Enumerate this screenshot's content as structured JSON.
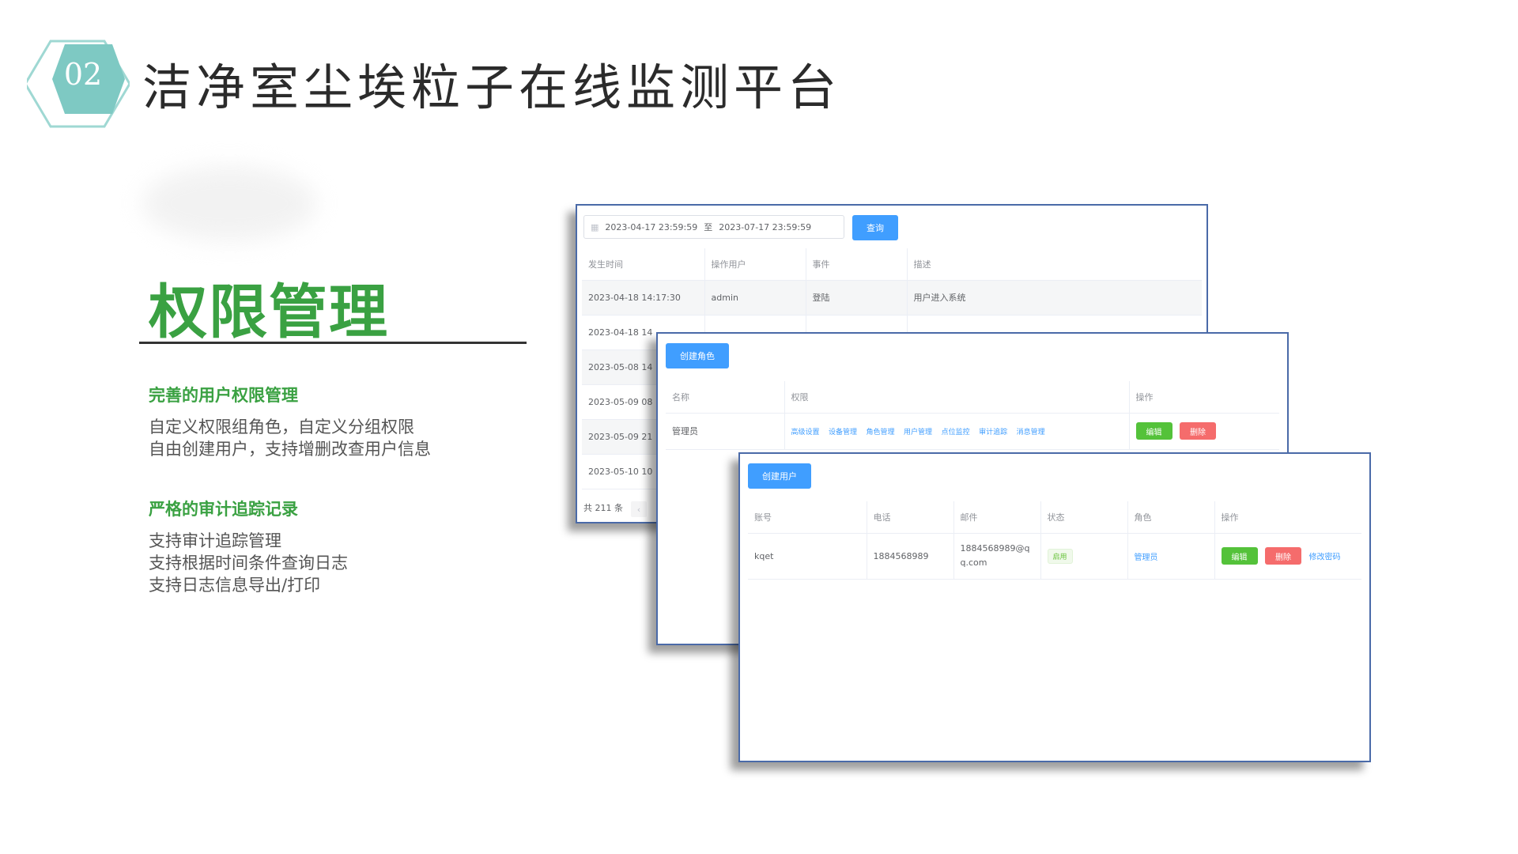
{
  "header": {
    "badge_number": "02",
    "title": "洁净室尘埃粒子在线监测平台",
    "colors": {
      "badge_fill": "#7ec9c3",
      "badge_outline": "#9fd8d3"
    }
  },
  "section": {
    "title": "权限管理",
    "features": [
      {
        "title": "完善的用户权限管理",
        "lines": [
          "自定义权限组角色，自定义分组权限",
          "自由创建用户，支持增删改查用户信息"
        ]
      },
      {
        "title": "严格的审计追踪记录",
        "lines": [
          "支持审计追踪管理",
          "支持根据时间条件查询日志",
          "支持日志信息导出/打印"
        ]
      }
    ]
  },
  "audit_panel": {
    "calendar_icon": "calendar-icon",
    "date_start": "2023-04-17 23:59:59",
    "date_separator": "至",
    "date_end": "2023-07-17 23:59:59",
    "query_label": "查询",
    "columns": [
      "发生时间",
      "操作用户",
      "事件",
      "描述"
    ],
    "rows": [
      {
        "time": "2023-04-18 14:17:30",
        "user": "admin",
        "event": "登陆",
        "desc": "用户进入系统"
      },
      {
        "time": "2023-04-18 14",
        "user": "",
        "event": "",
        "desc": ""
      },
      {
        "time": "2023-05-08 14",
        "user": "",
        "event": "",
        "desc": ""
      },
      {
        "time": "2023-05-09 08",
        "user": "",
        "event": "",
        "desc": ""
      },
      {
        "time": "2023-05-09 21",
        "user": "",
        "event": "",
        "desc": ""
      },
      {
        "time": "2023-05-10 10",
        "user": "",
        "event": "",
        "desc": ""
      }
    ],
    "total": "共 211 条",
    "prev_icon": "chevron-left-icon"
  },
  "role_panel": {
    "create_label": "创建角色",
    "columns": [
      "名称",
      "权限",
      "操作"
    ],
    "rows": [
      {
        "name": "管理员",
        "permissions": [
          "高级设置",
          "设备管理",
          "角色管理",
          "用户管理",
          "点位监控",
          "审计追踪",
          "消息管理"
        ],
        "edit": "编辑",
        "delete": "删除"
      }
    ]
  },
  "user_panel": {
    "create_label": "创建用户",
    "columns": [
      "账号",
      "电话",
      "邮件",
      "状态",
      "角色",
      "操作"
    ],
    "rows": [
      {
        "account": "kqet",
        "phone": "1884568989",
        "email_line1": "1884568989@q",
        "email_line2": "q.com",
        "status": "启用",
        "role": "管理员",
        "edit": "编辑",
        "delete": "删除",
        "change_password": "修改密码"
      }
    ]
  }
}
